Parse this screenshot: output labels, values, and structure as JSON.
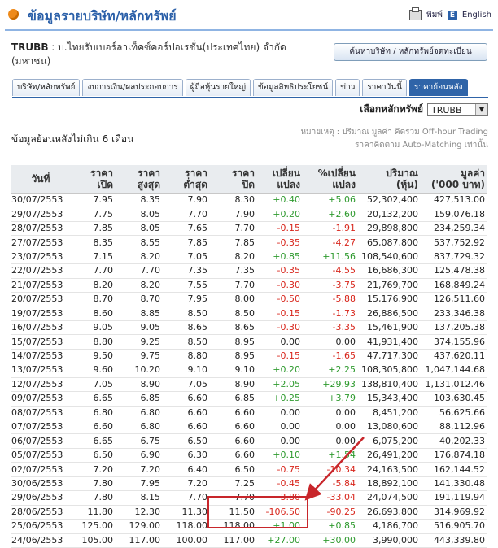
{
  "header": {
    "title": "ข้อมูลรายบริษัท/หลักทรัพย์",
    "print_label": "พิมพ์",
    "english_label": "English",
    "english_badge": "E"
  },
  "company": {
    "symbol": "TRUBB",
    "name": "บ.ไทยรับเบอร์ลาเท็คซ์คอร์ปอเรชั่น(ประเทศไทย) จำกัด (มหาชน)"
  },
  "search_button_label": "ค้นหาบริษัท / หลักทรัพย์จดทะเบียน",
  "tabs": [
    {
      "label": "บริษัท/หลักทรัพย์",
      "active": false
    },
    {
      "label": "งบการเงิน/ผลประกอบการ",
      "active": false
    },
    {
      "label": "ผู้ถือหุ้นรายใหญ่",
      "active": false
    },
    {
      "label": "ข้อมูลสิทธิประโยชน์",
      "active": false
    },
    {
      "label": "ข่าว",
      "active": false
    },
    {
      "label": "ราคาวันนี้",
      "active": false
    },
    {
      "label": "ราคาย้อนหลัง",
      "active": true
    }
  ],
  "security_select": {
    "label": "เลือกหลักทรัพย์",
    "value": "TRUBB",
    "arrow": "▼"
  },
  "notes": {
    "line1": "หมายเหตุ : ปริมาณ มูลค่า คิดรวม Off-hour Trading",
    "line2": "ราคาคิดตาม Auto-Matching เท่านั้น"
  },
  "range_label": "ข้อมูลย้อนหลังไม่เกิน 6 เดือน",
  "table": {
    "headers": [
      [
        "วันที่",
        ""
      ],
      [
        "ราคา",
        "เปิด"
      ],
      [
        "ราคา",
        "สูงสุด"
      ],
      [
        "ราคา",
        "ต่ำสุด"
      ],
      [
        "ราคา",
        "ปิด"
      ],
      [
        "เปลี่ยน",
        "แปลง"
      ],
      [
        "%เปลี่ยน",
        "แปลง"
      ],
      [
        "ปริมาณ",
        "(หุ้น)"
      ],
      [
        "มูลค่า",
        "('000 บาท)"
      ]
    ],
    "rows": [
      [
        "30/07/2553",
        "7.95",
        "8.35",
        "7.90",
        "8.30",
        "+0.40",
        "+5.06",
        "52,302,400",
        "427,513.00"
      ],
      [
        "29/07/2553",
        "7.75",
        "8.05",
        "7.70",
        "7.90",
        "+0.20",
        "+2.60",
        "20,132,200",
        "159,076.18"
      ],
      [
        "28/07/2553",
        "7.85",
        "8.05",
        "7.65",
        "7.70",
        "-0.15",
        "-1.91",
        "29,898,800",
        "234,259.34"
      ],
      [
        "27/07/2553",
        "8.35",
        "8.55",
        "7.85",
        "7.85",
        "-0.35",
        "-4.27",
        "65,087,800",
        "537,752.92"
      ],
      [
        "23/07/2553",
        "7.15",
        "8.20",
        "7.05",
        "8.20",
        "+0.85",
        "+11.56",
        "108,540,600",
        "837,729.32"
      ],
      [
        "22/07/2553",
        "7.70",
        "7.70",
        "7.35",
        "7.35",
        "-0.35",
        "-4.55",
        "16,686,300",
        "125,478.38"
      ],
      [
        "21/07/2553",
        "8.20",
        "8.20",
        "7.55",
        "7.70",
        "-0.30",
        "-3.75",
        "21,769,700",
        "168,849.24"
      ],
      [
        "20/07/2553",
        "8.70",
        "8.70",
        "7.95",
        "8.00",
        "-0.50",
        "-5.88",
        "15,176,900",
        "126,511.60"
      ],
      [
        "19/07/2553",
        "8.60",
        "8.85",
        "8.50",
        "8.50",
        "-0.15",
        "-1.73",
        "26,886,500",
        "233,346.38"
      ],
      [
        "16/07/2553",
        "9.05",
        "9.05",
        "8.65",
        "8.65",
        "-0.30",
        "-3.35",
        "15,461,900",
        "137,205.38"
      ],
      [
        "15/07/2553",
        "8.80",
        "9.25",
        "8.50",
        "8.95",
        "0.00",
        "0.00",
        "41,931,400",
        "374,155.96"
      ],
      [
        "14/07/2553",
        "9.50",
        "9.75",
        "8.80",
        "8.95",
        "-0.15",
        "-1.65",
        "47,717,300",
        "437,620.11"
      ],
      [
        "13/07/2553",
        "9.60",
        "10.20",
        "9.10",
        "9.10",
        "+0.20",
        "+2.25",
        "108,305,800",
        "1,047,144.68"
      ],
      [
        "12/07/2553",
        "7.05",
        "8.90",
        "7.05",
        "8.90",
        "+2.05",
        "+29.93",
        "138,810,400",
        "1,131,012.46"
      ],
      [
        "09/07/2553",
        "6.65",
        "6.85",
        "6.60",
        "6.85",
        "+0.25",
        "+3.79",
        "15,343,400",
        "103,630.45"
      ],
      [
        "08/07/2553",
        "6.80",
        "6.80",
        "6.60",
        "6.60",
        "0.00",
        "0.00",
        "8,451,200",
        "56,625.66"
      ],
      [
        "07/07/2553",
        "6.60",
        "6.80",
        "6.60",
        "6.60",
        "0.00",
        "0.00",
        "13,080,600",
        "88,112.96"
      ],
      [
        "06/07/2553",
        "6.65",
        "6.75",
        "6.50",
        "6.60",
        "0.00",
        "0.00",
        "6,075,200",
        "40,202.33"
      ],
      [
        "05/07/2553",
        "6.50",
        "6.90",
        "6.30",
        "6.60",
        "+0.10",
        "+1.54",
        "26,491,200",
        "176,874.18"
      ],
      [
        "02/07/2553",
        "7.20",
        "7.20",
        "6.40",
        "6.50",
        "-0.75",
        "-10.34",
        "24,163,500",
        "162,144.52"
      ],
      [
        "30/06/2553",
        "7.80",
        "7.95",
        "7.20",
        "7.25",
        "-0.45",
        "-5.84",
        "18,892,100",
        "141,330.48"
      ],
      [
        "29/06/2553",
        "7.80",
        "8.15",
        "7.70",
        "7.70",
        "-3.80",
        "-33.04",
        "24,074,500",
        "191,119.94"
      ],
      [
        "28/06/2553",
        "11.80",
        "12.30",
        "11.30",
        "11.50",
        "-106.50",
        "-90.25",
        "26,693,800",
        "314,969.92"
      ],
      [
        "25/06/2553",
        "125.00",
        "129.00",
        "118.00",
        "118.00",
        "+1.00",
        "+0.85",
        "4,186,700",
        "516,905.70"
      ],
      [
        "24/06/2553",
        "105.00",
        "117.00",
        "100.00",
        "117.00",
        "+27.00",
        "+30.00",
        "3,990,000",
        "443,339.80"
      ]
    ]
  },
  "colors": {
    "positive": "#2e9a2e",
    "negative": "#d8261c",
    "tab_active": "#2f64a8",
    "title": "#2a5fa8",
    "highlight": "#c8262b"
  }
}
